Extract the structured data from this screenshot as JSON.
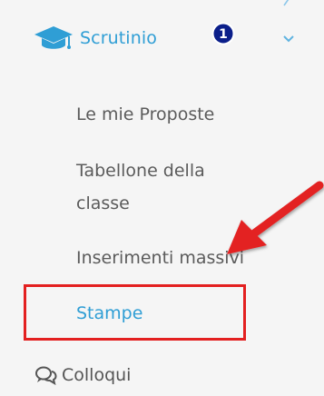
{
  "section": {
    "label": "Scrutinio",
    "icon": "graduation-cap-icon",
    "badge": "1",
    "accent_color": "#2f9ed5"
  },
  "submenu": {
    "items": [
      {
        "label": "Le mie Proposte"
      },
      {
        "label": "Tabellone della classe"
      },
      {
        "label": "Inserimenti massivi"
      },
      {
        "label": "Stampe",
        "active": true
      }
    ]
  },
  "next_section": {
    "label": "Colloqui",
    "icon": "chat-bubbles-icon"
  },
  "annotation": {
    "highlight_color": "#e32020",
    "arrow_color": "#e32020"
  }
}
